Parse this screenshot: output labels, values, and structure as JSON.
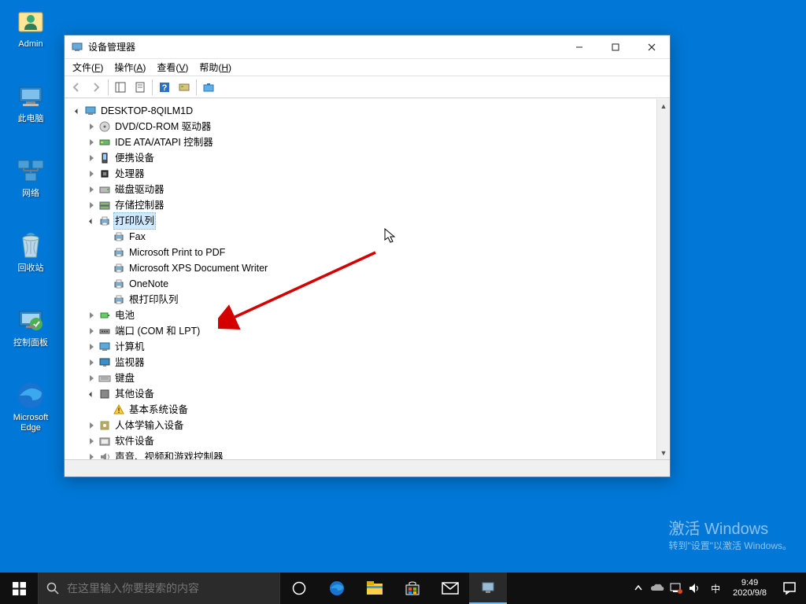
{
  "desktop_icons": [
    {
      "id": "admin",
      "label": "Admin"
    },
    {
      "id": "thispc",
      "label": "此电脑"
    },
    {
      "id": "network",
      "label": "网络"
    },
    {
      "id": "recyclebin",
      "label": "回收站"
    },
    {
      "id": "controlpanel",
      "label": "控制面板"
    },
    {
      "id": "edge",
      "label": "Microsoft\nEdge"
    }
  ],
  "window": {
    "title": "设备管理器",
    "menus": [
      {
        "label": "文件",
        "accel": "F"
      },
      {
        "label": "操作",
        "accel": "A"
      },
      {
        "label": "查看",
        "accel": "V"
      },
      {
        "label": "帮助",
        "accel": "H"
      }
    ]
  },
  "tree": {
    "root": "DESKTOP-8QILM1D",
    "nodes": [
      {
        "label": "DVD/CD-ROM 驱动器",
        "icon": "disc",
        "exp": "closed"
      },
      {
        "label": "IDE ATA/ATAPI 控制器",
        "icon": "ide",
        "exp": "closed"
      },
      {
        "label": "便携设备",
        "icon": "portable",
        "exp": "closed"
      },
      {
        "label": "处理器",
        "icon": "cpu",
        "exp": "closed"
      },
      {
        "label": "磁盘驱动器",
        "icon": "disk",
        "exp": "closed"
      },
      {
        "label": "存储控制器",
        "icon": "storage",
        "exp": "closed"
      },
      {
        "label": "打印队列",
        "icon": "printer",
        "exp": "open",
        "selected": true,
        "children": [
          {
            "label": "Fax",
            "icon": "printer"
          },
          {
            "label": "Microsoft Print to PDF",
            "icon": "printer"
          },
          {
            "label": "Microsoft XPS Document Writer",
            "icon": "printer"
          },
          {
            "label": "OneNote",
            "icon": "printer"
          },
          {
            "label": "根打印队列",
            "icon": "printer"
          }
        ]
      },
      {
        "label": "电池",
        "icon": "battery",
        "exp": "closed"
      },
      {
        "label": "端口 (COM 和 LPT)",
        "icon": "port",
        "exp": "closed"
      },
      {
        "label": "计算机",
        "icon": "computer",
        "exp": "closed"
      },
      {
        "label": "监视器",
        "icon": "monitor",
        "exp": "closed"
      },
      {
        "label": "键盘",
        "icon": "keyboard",
        "exp": "closed"
      },
      {
        "label": "其他设备",
        "icon": "other",
        "exp": "open",
        "children": [
          {
            "label": "基本系统设备",
            "icon": "warn"
          }
        ]
      },
      {
        "label": "人体学输入设备",
        "icon": "hid",
        "exp": "closed"
      },
      {
        "label": "软件设备",
        "icon": "software",
        "exp": "closed"
      },
      {
        "label": "声音、视频和游戏控制器",
        "icon": "audio",
        "exp": "closed"
      }
    ]
  },
  "watermark": {
    "l1": "激活 Windows",
    "l2": "转到\"设置\"以激活 Windows。"
  },
  "taskbar": {
    "search_placeholder": "在这里输入你要搜索的内容",
    "clock": {
      "time": "9:49",
      "date": "2020/9/8"
    },
    "ime": "中"
  }
}
